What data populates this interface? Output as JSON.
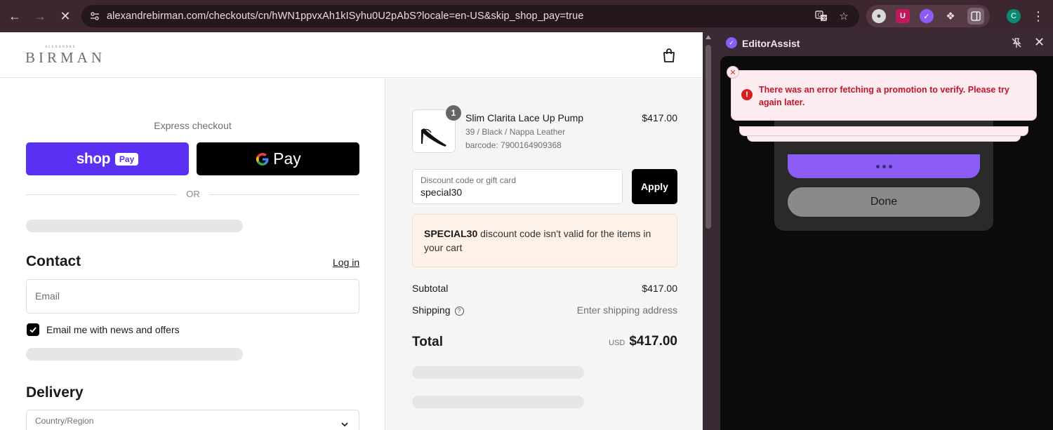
{
  "browser": {
    "url": "alexandrebirman.com/checkouts/cn/hWN1ppvxAh1kISyhu0U2pAbS?locale=en-US&skip_shop_pay=true",
    "profile_initial": "C"
  },
  "site": {
    "logo_small": "ALEXANDRE",
    "logo": "BIRMAN"
  },
  "checkout": {
    "express_label": "Express checkout",
    "shoppay_label": "shop",
    "shoppay_pill": "Pay",
    "gpay_label": "Pay",
    "or_label": "OR",
    "contact_title": "Contact",
    "login_label": "Log in",
    "email_placeholder": "Email",
    "newsletter_label": "Email me with news and offers",
    "newsletter_checked": true,
    "delivery_title": "Delivery",
    "country_label": "Country/Region"
  },
  "summary": {
    "qty": "1",
    "product_name": "Slim Clarita Lace Up Pump",
    "product_variant": "39 / Black / Nappa Leather",
    "product_barcode": "barcode: 7900164909368",
    "product_price": "$417.00",
    "discount_placeholder": "Discount code or gift card",
    "discount_value": "special30",
    "apply_label": "Apply",
    "notice_code": "SPECIAL30",
    "notice_text": " discount code isn't valid for the items in your cart",
    "subtotal_label": "Subtotal",
    "subtotal_value": "$417.00",
    "shipping_label": "Shipping",
    "shipping_value": "Enter shipping address",
    "total_label": "Total",
    "total_currency": "USD",
    "total_value": "$417.00"
  },
  "panel": {
    "title": "EditorAssist",
    "toast_text": "There was an error fetching a promotion to verify. Please try again later.",
    "done_label": "Done"
  }
}
